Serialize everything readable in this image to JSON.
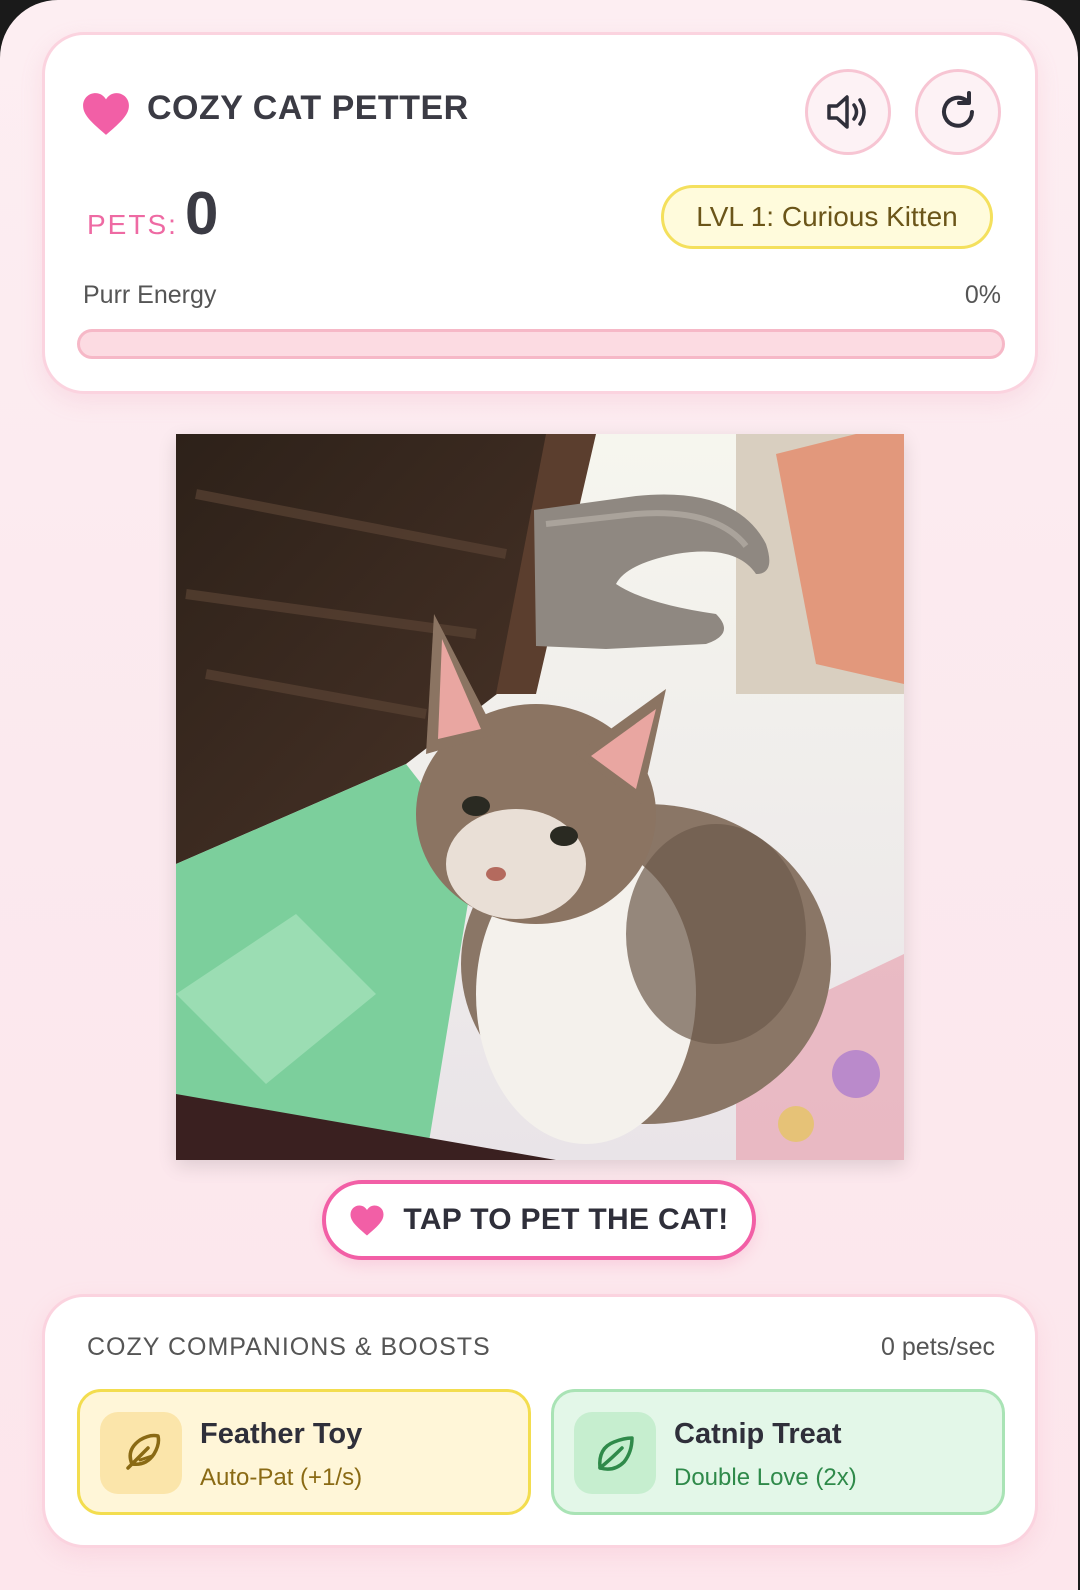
{
  "header": {
    "title": "COZY CAT PETTER",
    "sound_icon": "speaker-icon",
    "reset_icon": "refresh-icon"
  },
  "stats": {
    "pets_label": "PETS:",
    "pets_value": "0",
    "level": "LVL 1: Curious Kitten"
  },
  "energy": {
    "label": "Purr Energy",
    "percent_text": "0%",
    "value": 0
  },
  "pet_button": {
    "label": "TAP TO PET THE CAT!"
  },
  "boosts": {
    "title": "COZY COMPANIONS & BOOSTS",
    "rate": "0 pets/sec",
    "items": [
      {
        "name": "Feather Toy",
        "desc": "Auto-Pat (+1/s)",
        "icon": "feather-icon"
      },
      {
        "name": "Catnip Treat",
        "desc": "Double Love (2x)",
        "icon": "leaf-icon"
      }
    ]
  },
  "colors": {
    "accent_pink": "#ee6aa3",
    "level_yellow": "#f4e05d",
    "catnip_green": "#a9e3b5"
  }
}
